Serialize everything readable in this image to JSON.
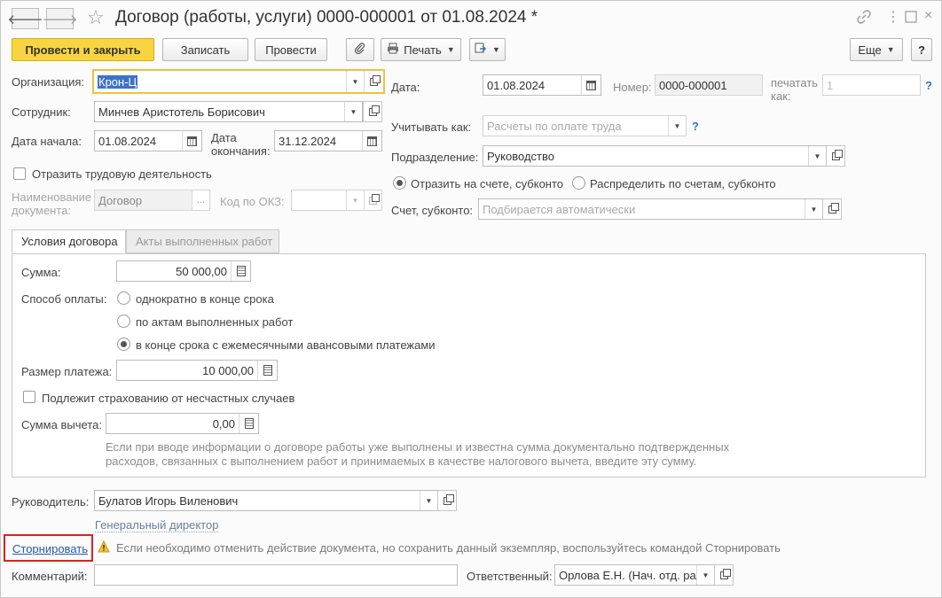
{
  "window": {
    "title": "Договор (работы, услуги) 0000-000001 от 01.08.2024 *",
    "icons": [
      "back-icon",
      "forward-icon",
      "star-icon",
      "link-icon",
      "more-vertical-icon",
      "maximize-icon",
      "close-icon"
    ]
  },
  "toolbar": {
    "post_close": "Провести и закрыть",
    "save": "Записать",
    "post": "Провести",
    "print": "Печать",
    "more": "Еще"
  },
  "form": {
    "org_label": "Организация:",
    "org_value": "Крон-Ц",
    "employee_label": "Сотрудник:",
    "employee_value": "Минчев Аристотель Борисович",
    "start_label": "Дата начала:",
    "start_value": "01.08.2024",
    "end_label_1": "Дата",
    "end_label_2": "окончания:",
    "end_value": "31.12.2024",
    "labor_checkbox": "Отразить трудовую деятельность",
    "docname_label_1": "Наименование",
    "docname_label_2": "документа:",
    "docname_value": "Договор",
    "okz_label": "Код по ОКЗ:",
    "date_label": "Дата:",
    "date_value": "01.08.2024",
    "number_label": "Номер:",
    "number_value": "0000-000001",
    "print_as_label_1": "печатать",
    "print_as_label_2": "как:",
    "print_as_value": "1",
    "account_as_label": "Учитывать как:",
    "account_as_placeholder": "Расчеты по оплате труда",
    "division_label": "Подразделение:",
    "division_value": "Руководство",
    "radio_account": "Отразить на счете, субконто",
    "radio_distribute": "Распределить по счетам, субконто",
    "account_label": "Счет, субконто:",
    "account_placeholder": "Подбирается автоматически",
    "help": "?"
  },
  "tabs": [
    {
      "label": "Условия договора",
      "active": true
    },
    {
      "label": "Акты выполненных работ",
      "active": false
    }
  ],
  "conditions": {
    "sum_label": "Сумма:",
    "sum_value": "50 000,00",
    "payment_label": "Способ оплаты:",
    "payment_options": [
      "однократно в конце срока",
      "по актам выполненных работ",
      "в конце срока с ежемесячными авансовыми платежами"
    ],
    "payment_selected": 2,
    "payment_size_label": "Размер платежа:",
    "payment_size_value": "10 000,00",
    "insurance_checkbox": "Подлежит страхованию от несчастных случаев",
    "deduction_label": "Сумма вычета:",
    "deduction_value": "0,00",
    "hint_line1": "Если при вводе информации о договоре работы уже выполнены и известна сумма документально подтвержденных",
    "hint_line2": "расходов, связанных с выполнением работ и принимаемых в качестве налогового вычета, введите эту сумму."
  },
  "footer": {
    "manager_label": "Руководитель:",
    "manager_value": "Булатов Игорь Виленович",
    "manager_position": "Генеральный директор",
    "reverse_link": "Сторнировать",
    "reverse_hint": "Если необходимо отменить действие документа, но сохранить данный экземпляр, воспользуйтесь командой Сторнировать",
    "comment_label": "Комментарий:",
    "comment_value": "",
    "responsible_label": "Ответственный:",
    "responsible_value": "Орлова Е.Н. (Нач. отд. ра"
  },
  "colors": {
    "primary_button": "#f8d540",
    "link": "#2659a8",
    "help": "#2d7ac5",
    "highlight_border": "#e11f1f",
    "focus_border": "#f0c040"
  }
}
